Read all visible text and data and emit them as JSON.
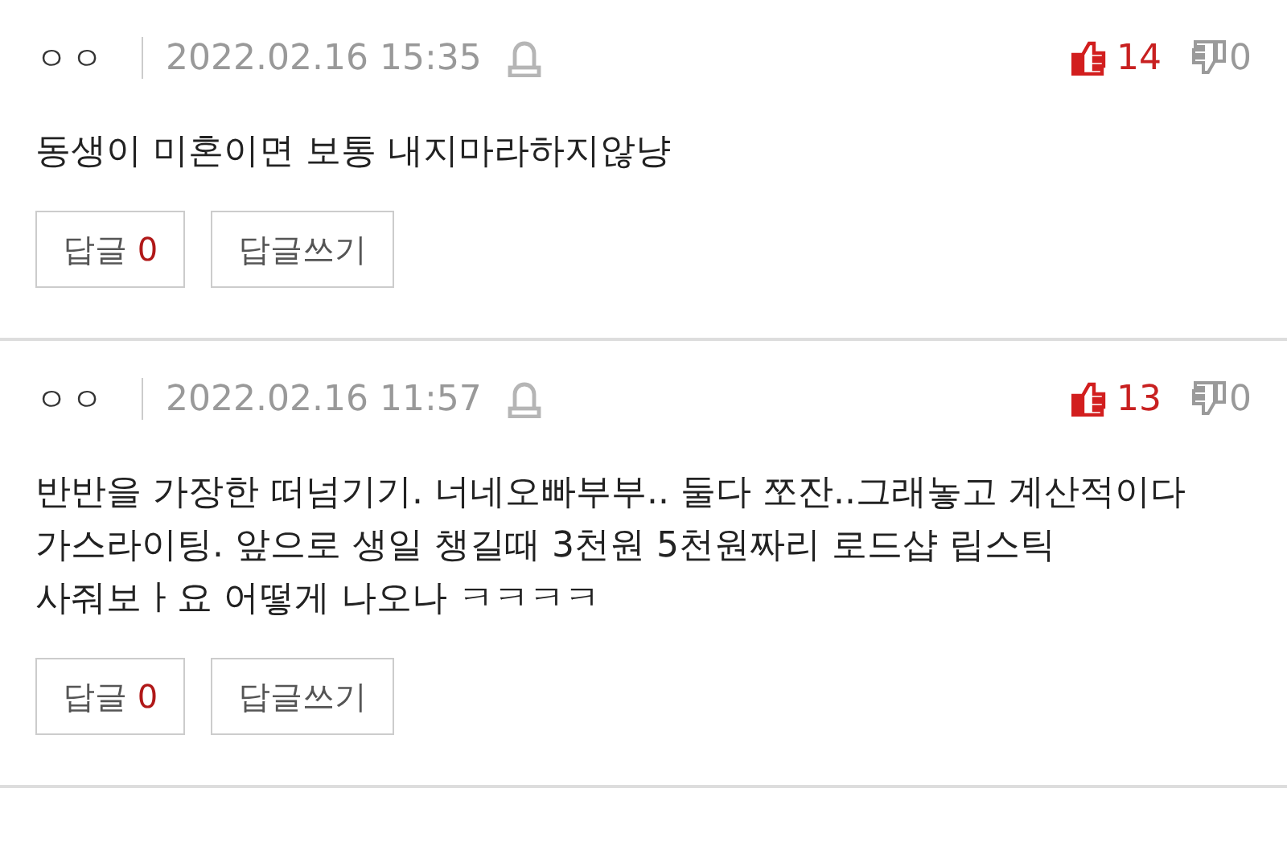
{
  "comments": [
    {
      "author": "ㅇㅇ",
      "date": "2022.02.16 15:35",
      "likes": "14",
      "dislikes": "0",
      "text": "동생이 미혼이면 보통 내지마라하지않냥",
      "reply_label": "답글",
      "reply_count": "0",
      "write_label": "답글쓰기"
    },
    {
      "author": "ㅇㅇ",
      "date": "2022.02.16 11:57",
      "likes": "13",
      "dislikes": "0",
      "text": "반반을 가장한 떠넘기기. 너네오빠부부.. 둘다 쪼잔..그래놓고 계산적이다 가스라이팅. 앞으로 생일 챙길때 3천원 5천원짜리 로드샵 립스틱 사줘보ㅏ요 어떻게 나오나 ㅋㅋㅋㅋ",
      "reply_label": "답글",
      "reply_count": "0",
      "write_label": "답글쓰기"
    }
  ]
}
